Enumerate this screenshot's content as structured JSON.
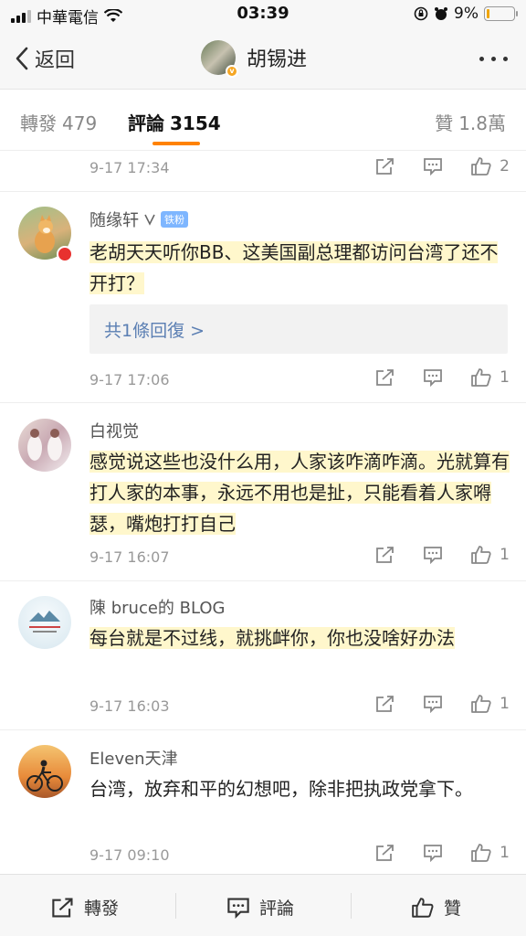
{
  "status_bar": {
    "carrier": "中華電信",
    "time": "03:39",
    "battery": "9%",
    "battery_level": 0.09
  },
  "header": {
    "back_label": "返回",
    "title": "胡锡进"
  },
  "tabs": [
    {
      "label": "轉發",
      "count": "479"
    },
    {
      "label": "評論",
      "count": "3154"
    },
    {
      "label": "贊",
      "count": "1.8萬"
    }
  ],
  "comments": [
    {
      "time": "9-17 17:34",
      "likes": "2"
    },
    {
      "username": "随缘轩",
      "fan_badge": "铁粉",
      "text": "老胡天天听你BB、这美国副总理都访问台湾了还不开打？",
      "reply_link": "共1條回復 >",
      "time": "9-17 17:06",
      "likes": "1"
    },
    {
      "username": "白视觉",
      "text": "感觉说这些也没什么用，人家该咋滴咋滴。光就算有打人家的本事，永远不用也是扯，只能看着人家嘚瑟，嘴炮打打自己",
      "time": "9-17 16:07",
      "likes": "1"
    },
    {
      "username": "陳 bruce的 BLOG",
      "text": "每台就是不过线，就挑衅你，你也没啥好办法",
      "time": "9-17 16:03",
      "likes": "1"
    },
    {
      "username": "Eleven天津",
      "text": "台湾，放弃和平的幻想吧，除非把执政党拿下。",
      "time": "9-17 09:10",
      "likes": "1"
    }
  ],
  "bottom_bar": {
    "repost": "轉發",
    "comment": "評論",
    "like": "贊"
  },
  "colors": {
    "accent": "#ff8200",
    "link": "#5b7fb3",
    "highlight": "#fff7cc",
    "fan_badge": "#7eb6ff",
    "vip_badge": "#f5a623",
    "battery_fill": "#f0a500"
  }
}
